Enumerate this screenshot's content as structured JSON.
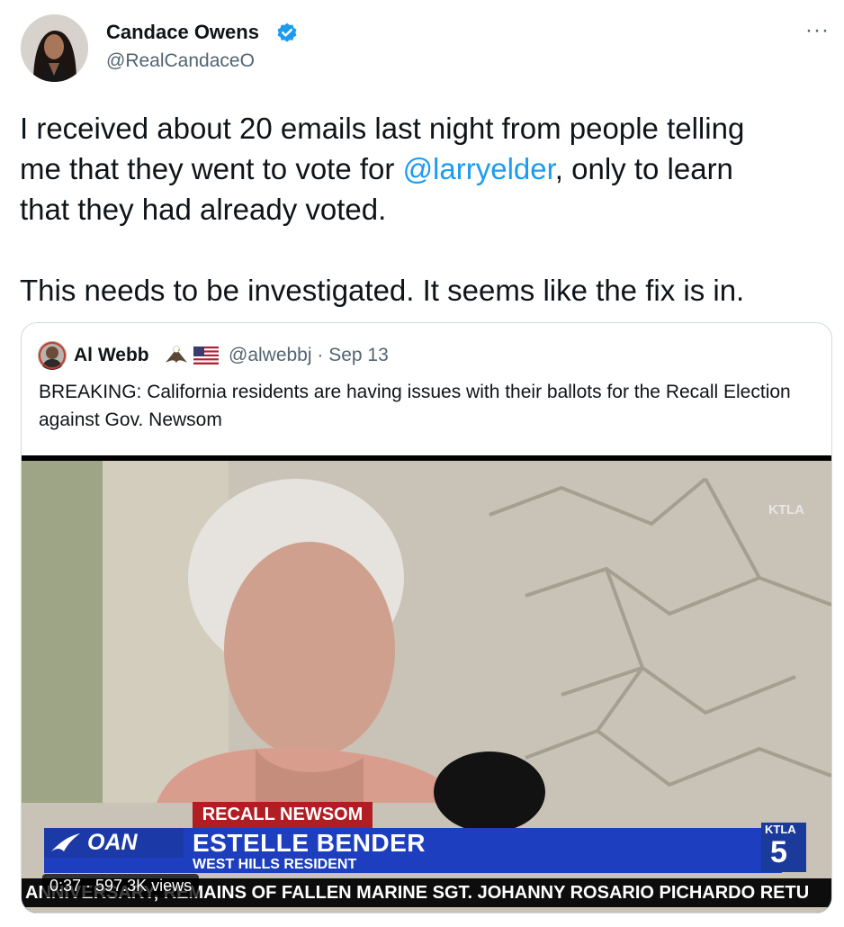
{
  "author": {
    "name": "Candace Owens",
    "handle": "@RealCandaceO",
    "verified_icon": "verified-badge-icon",
    "more_icon": "more-icon",
    "more_label": "···"
  },
  "tweet": {
    "text_line1": "I received about 20 emails last night from people telling\nme that they went to vote for ",
    "mention": "@larryelder",
    "text_line2": ", only to learn\nthat they had already voted.\n\nThis needs to be investigated. It seems like the fix is in."
  },
  "quote": {
    "name": "Al Webb",
    "emoji_icons": [
      "eagle-icon",
      "us-flag-icon"
    ],
    "handle_date": "@alwebbj · Sep 13",
    "text": "BREAKING: California residents are having issues with their ballots for the Recall Election against Gov. Newsom",
    "video": {
      "watermark": "KTLA",
      "recall_label": "RECALL NEWSOM",
      "network": "OAN",
      "guest_name": "ESTELLE BENDER",
      "guest_title": "WEST HILLS RESIDENT",
      "station_small": "KTLA",
      "station_num": "5",
      "ticker": "ANNIVERSARY, REMAINS OF FALLEN MARINE SGT. JOHANNY ROSARIO PICHARDO RETU",
      "meta": "0:37 · 597.3K views"
    }
  },
  "colors": {
    "link": "#1d9bf0",
    "secondary_text": "#536471",
    "border": "#cfd9de",
    "news_red": "#b01e23",
    "news_blue": "#1d3fbf"
  }
}
